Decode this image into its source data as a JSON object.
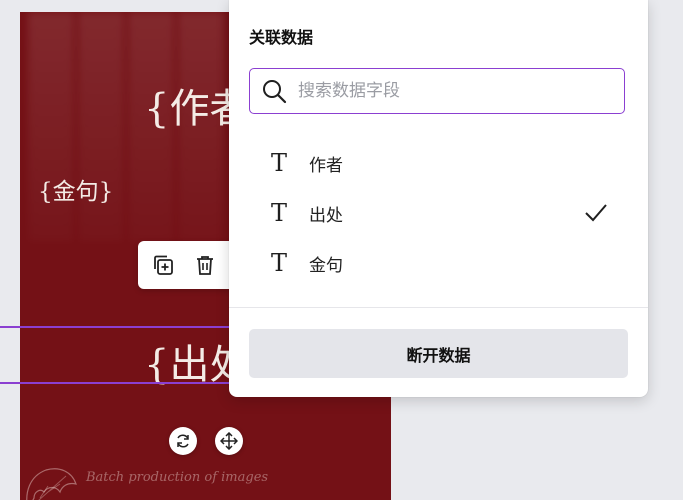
{
  "canvas": {
    "placeholder_author": "{作者",
    "placeholder_quote": "{金句}",
    "placeholder_source": "{出处",
    "script_text": "Batch production of images",
    "background_color": "#741116"
  },
  "toolbar": {
    "duplicate_icon": "duplicate-icon",
    "delete_icon": "trash-icon"
  },
  "handles": {
    "rotate_icon": "rotate-icon",
    "move_icon": "move-icon"
  },
  "popover": {
    "title": "关联数据",
    "search": {
      "placeholder": "搜索数据字段",
      "value": ""
    },
    "fields": [
      {
        "label": "作者",
        "icon": "text-type-icon",
        "selected": false
      },
      {
        "label": "出处",
        "icon": "text-type-icon",
        "selected": true
      },
      {
        "label": "金句",
        "icon": "text-type-icon",
        "selected": false
      }
    ],
    "disconnect_label": "断开数据"
  },
  "colors": {
    "accent": "#8b3fd1",
    "canvas_bg": "#741116",
    "workspace_bg": "#e9eaee"
  }
}
